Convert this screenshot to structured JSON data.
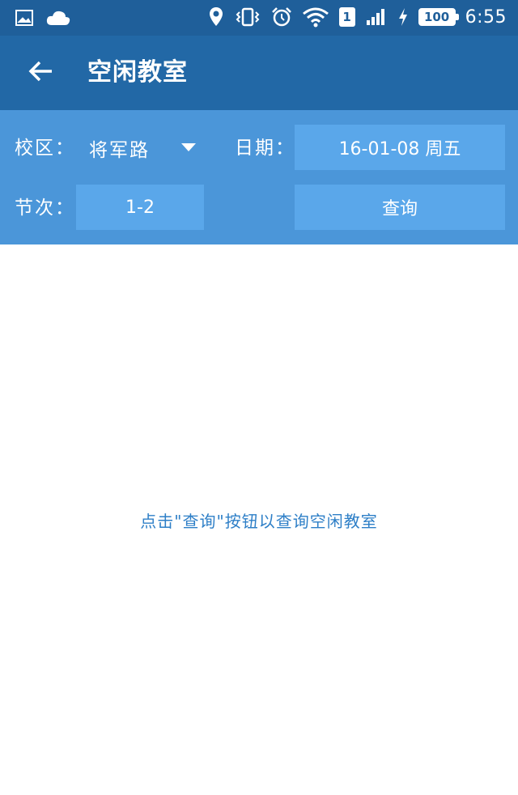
{
  "status_bar": {
    "sim_label": "1",
    "battery_level": "100",
    "time": "6:55",
    "icons_left": [
      "image-icon",
      "cloud-icon"
    ],
    "icons_right": [
      "location-icon",
      "vibrate-icon",
      "alarm-icon",
      "wifi-icon",
      "sim-icon",
      "signal-icon",
      "charging-icon",
      "battery-icon"
    ]
  },
  "app_bar": {
    "title": "空闲教室",
    "back_icon": "arrow-left-icon",
    "background": "#2268a6"
  },
  "filters": {
    "campus_label": "校区：",
    "campus_value": "将军路",
    "date_label": "日期：",
    "date_value": "16-01-08 周五",
    "period_label": "节次：",
    "period_value": "1-2",
    "query_button": "查询",
    "background": "#4b96d9"
  },
  "content": {
    "hint": "点击\"查询\"按钮以查询空闲教室"
  }
}
